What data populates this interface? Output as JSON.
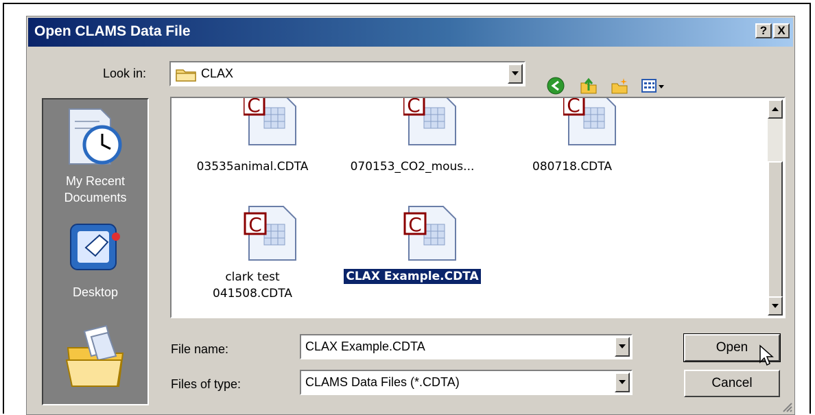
{
  "dialog": {
    "title": "Open CLAMS Data File",
    "help_button": "?",
    "close_button": "X"
  },
  "lookin": {
    "label": "Look in:",
    "value": "CLAX",
    "folder_icon": "folder-icon"
  },
  "toolbar": {
    "icons": [
      "back-arrow-icon",
      "up-folder-icon",
      "new-folder-icon",
      "views-menu-icon"
    ]
  },
  "places": [
    {
      "label_line1": "My Recent",
      "label_line2": "Documents",
      "icon": "recent-documents-icon"
    },
    {
      "label_line1": "Desktop",
      "label_line2": "",
      "icon": "desktop-icon"
    },
    {
      "label_line1": "",
      "label_line2": "",
      "icon": "my-documents-icon"
    }
  ],
  "files": [
    {
      "name_line1": "03535animal.CDTA",
      "name_line2": "",
      "selected": false
    },
    {
      "name_line1": "070153_CO2_mous...",
      "name_line2": "",
      "selected": false
    },
    {
      "name_line1": "080718.CDTA",
      "name_line2": "",
      "selected": false
    },
    {
      "name_line1": "clark test",
      "name_line2": "041508.CDTA",
      "selected": false
    },
    {
      "name_line1": "CLAX Example.CDTA",
      "name_line2": "",
      "selected": true
    }
  ],
  "file_icon_letter": "C",
  "filename": {
    "label": "File name:",
    "value": "CLAX Example.CDTA"
  },
  "filetype": {
    "label": "Files of type:",
    "value": "CLAMS Data Files (*.CDTA)"
  },
  "buttons": {
    "open": "Open",
    "cancel": "Cancel"
  },
  "colors": {
    "title_start": "#0a246a",
    "title_end": "#a6caf0",
    "dialog_bg": "#d4d0c8",
    "selection": "#0a246a",
    "clams_red": "#8b0000"
  }
}
